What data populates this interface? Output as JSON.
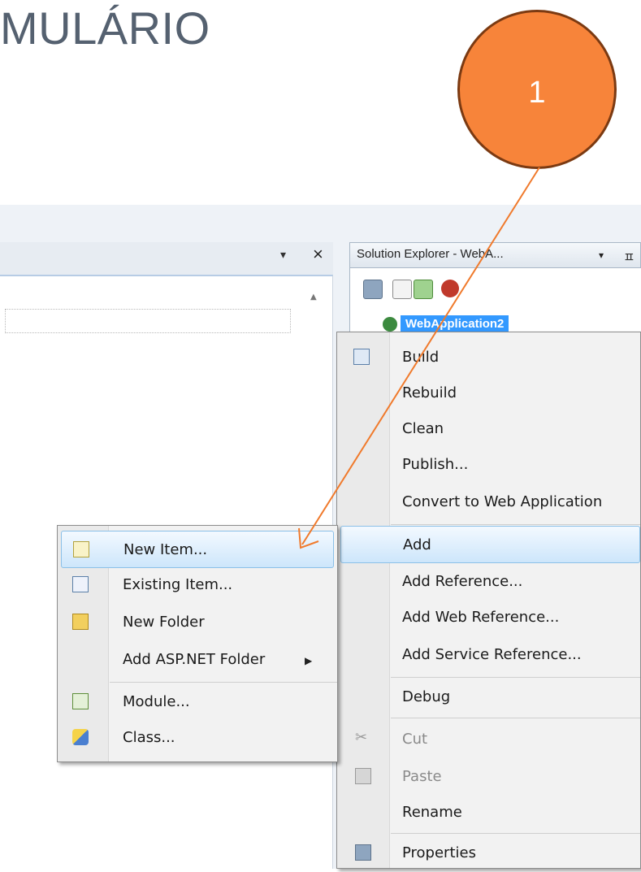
{
  "slide": {
    "title_fragment": "MULÁRIO"
  },
  "callout": {
    "number": "1",
    "color": "#f7843a"
  },
  "document": {
    "pin_glyph": "▾",
    "close_glyph": "×",
    "scroll_glyph": "▲"
  },
  "solution_explorer": {
    "title": "Solution Explorer - WebA...",
    "dropdown_glyph": "▾",
    "pin_glyph": "ㅍ",
    "project_node": "WebApplication2"
  },
  "project_menu": {
    "items": [
      {
        "label": "Build",
        "icon": "build-icon"
      },
      {
        "label": "Rebuild"
      },
      {
        "label": "Clean"
      },
      {
        "label": "Publish..."
      },
      {
        "label": "Convert to Web Application"
      },
      {
        "label": "Add"
      },
      {
        "label": "Add Reference..."
      },
      {
        "label": "Add Web Reference..."
      },
      {
        "label": "Add Service Reference..."
      },
      {
        "label": "Debug"
      },
      {
        "label": "Cut",
        "icon": "scissors-icon"
      },
      {
        "label": "Paste",
        "icon": "clipboard-icon"
      },
      {
        "label": "Rename"
      },
      {
        "label": "Properties",
        "icon": "properties-icon"
      }
    ]
  },
  "add_submenu": {
    "items": [
      {
        "label": "New Item...",
        "icon": "new-item-icon"
      },
      {
        "label": "Existing Item...",
        "icon": "existing-item-icon"
      },
      {
        "label": "New Folder",
        "icon": "new-folder-icon"
      },
      {
        "label": "Add ASP.NET Folder",
        "icon": ""
      },
      {
        "label": "Module...",
        "icon": "module-icon"
      },
      {
        "label": "Class...",
        "icon": "class-icon"
      }
    ],
    "submenu_glyph": "▶"
  },
  "colors": {
    "highlight_border": "#8bc0e8",
    "arrow": "#f07a2c",
    "selection": "#3399ff"
  }
}
